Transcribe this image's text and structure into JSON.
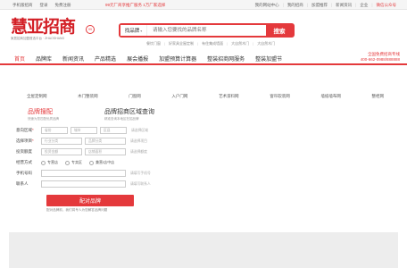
{
  "topbar": {
    "mobile": "手机版招商",
    "login": "登录",
    "register": "免费注册",
    "promo": "99元厂商享推广服务  1万厂家选择",
    "links": [
      "我的网站中心",
      "我的招商",
      "加盟推荐",
      "新闻资讯",
      "企业",
      "微信公众号"
    ]
  },
  "logo": {
    "text": "慧亚招商",
    "sub": "家居招商加盟首选平台 · ZHAOSHANG",
    "badge": "99"
  },
  "search": {
    "category": "找品牌",
    "placeholder": "请输入您要找的品牌名称",
    "button": "搜索"
  },
  "hotkeys": [
    "餐饮门窗",
    "好家具全屋定制",
    "有住集成墙面",
    "大自然木门",
    "大自然木门"
  ],
  "nav": {
    "items": [
      "首页",
      "品牌库",
      "新闻资讯",
      "产品精选",
      "展会播报",
      "加盟预算计算器",
      "整装招商网服务",
      "整装加盟节"
    ],
    "active": 0,
    "hotline_label": "全国免费招商专线",
    "hotline": "400-662-0988/888888"
  },
  "categories": [
    "全屋定制网",
    "木门整装网",
    "门窗网",
    "入户门网",
    "艺术漆料网",
    "窗帘软装网",
    "墙纸墙布网",
    "整柜网"
  ],
  "form": {
    "title": "品牌搜配",
    "subtitle": "快速为您匹配优质品牌",
    "query_title": "品牌招商区域查询",
    "query_subtitle": "精准查询本地区在招品牌",
    "region_label": "意向区域",
    "region_fields": [
      "省份",
      "城市",
      "区县"
    ],
    "region_hint": "请选择区域",
    "category_label": "选择项目",
    "category_fields": [
      "行业分类",
      "品牌分类"
    ],
    "category_hint": "请选择项目",
    "budget_label": "投资额度",
    "budget_fields": [
      "投资金额",
      "店铺面积"
    ],
    "budget_hint": "请选择额度",
    "method_label": "经营方式",
    "methods": [
      "专营店",
      "专卖区",
      "兼营/店中店"
    ],
    "phone_label": "手机号码",
    "phone_hint": "请填写手机号",
    "contact_label": "联系人",
    "contact_hint": "请填写联系人",
    "submit": "配对品牌",
    "note": "配对品牌前，我们将专人为您解答品牌问题"
  }
}
